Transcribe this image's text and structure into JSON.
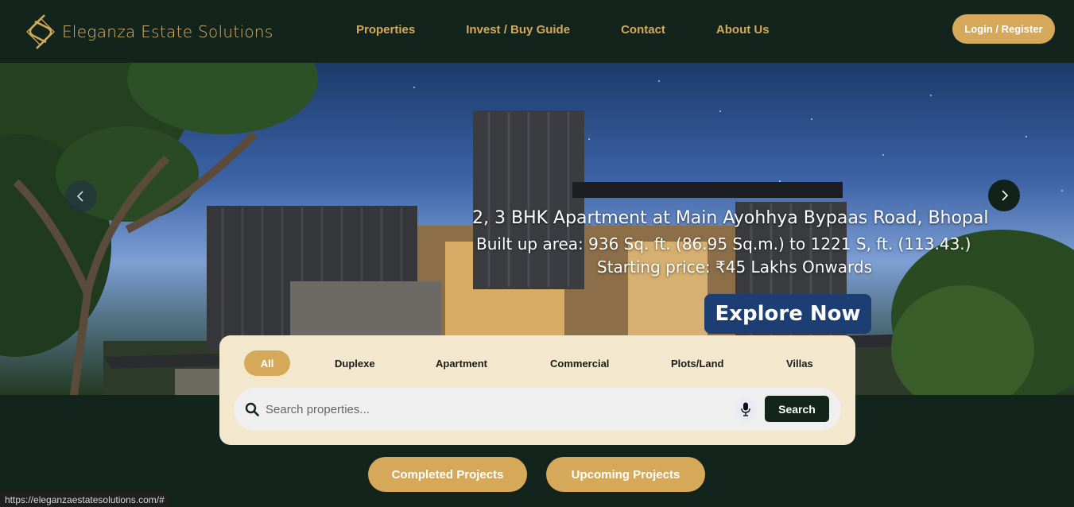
{
  "brand": {
    "name": "Eleganza Estate Solutions",
    "logo_icon": "s-monogram-icon"
  },
  "nav": {
    "items": [
      "Properties",
      "Invest / Buy Guide",
      "Contact",
      "About Us"
    ]
  },
  "auth": {
    "login_label": "Login / Register"
  },
  "hero": {
    "line1": "2, 3 BHK Apartment at Main Ayohhya Bypaas Road, Bhopal",
    "line2": "Built up area: 936 Sq. ft. (86.95 Sq.m.) to 1221 S, ft. (113.43.)",
    "line3": "Starting price: ₹45 Lakhs Onwards",
    "cta": "Explore Now"
  },
  "search": {
    "tabs": [
      "All",
      "Duplexe",
      "Apartment",
      "Commercial",
      "Plots/Land",
      "Villas"
    ],
    "active_tab": "All",
    "placeholder": "Search properties...",
    "button_label": "Search"
  },
  "projects": {
    "completed": "Completed Projects",
    "upcoming": "Upcoming Projects"
  },
  "status_bar": {
    "url": "https://eleganzaestatesolutions.com/#"
  },
  "colors": {
    "background": "#13241d",
    "accent": "#d6a95a",
    "panel": "#f3e8cd"
  }
}
